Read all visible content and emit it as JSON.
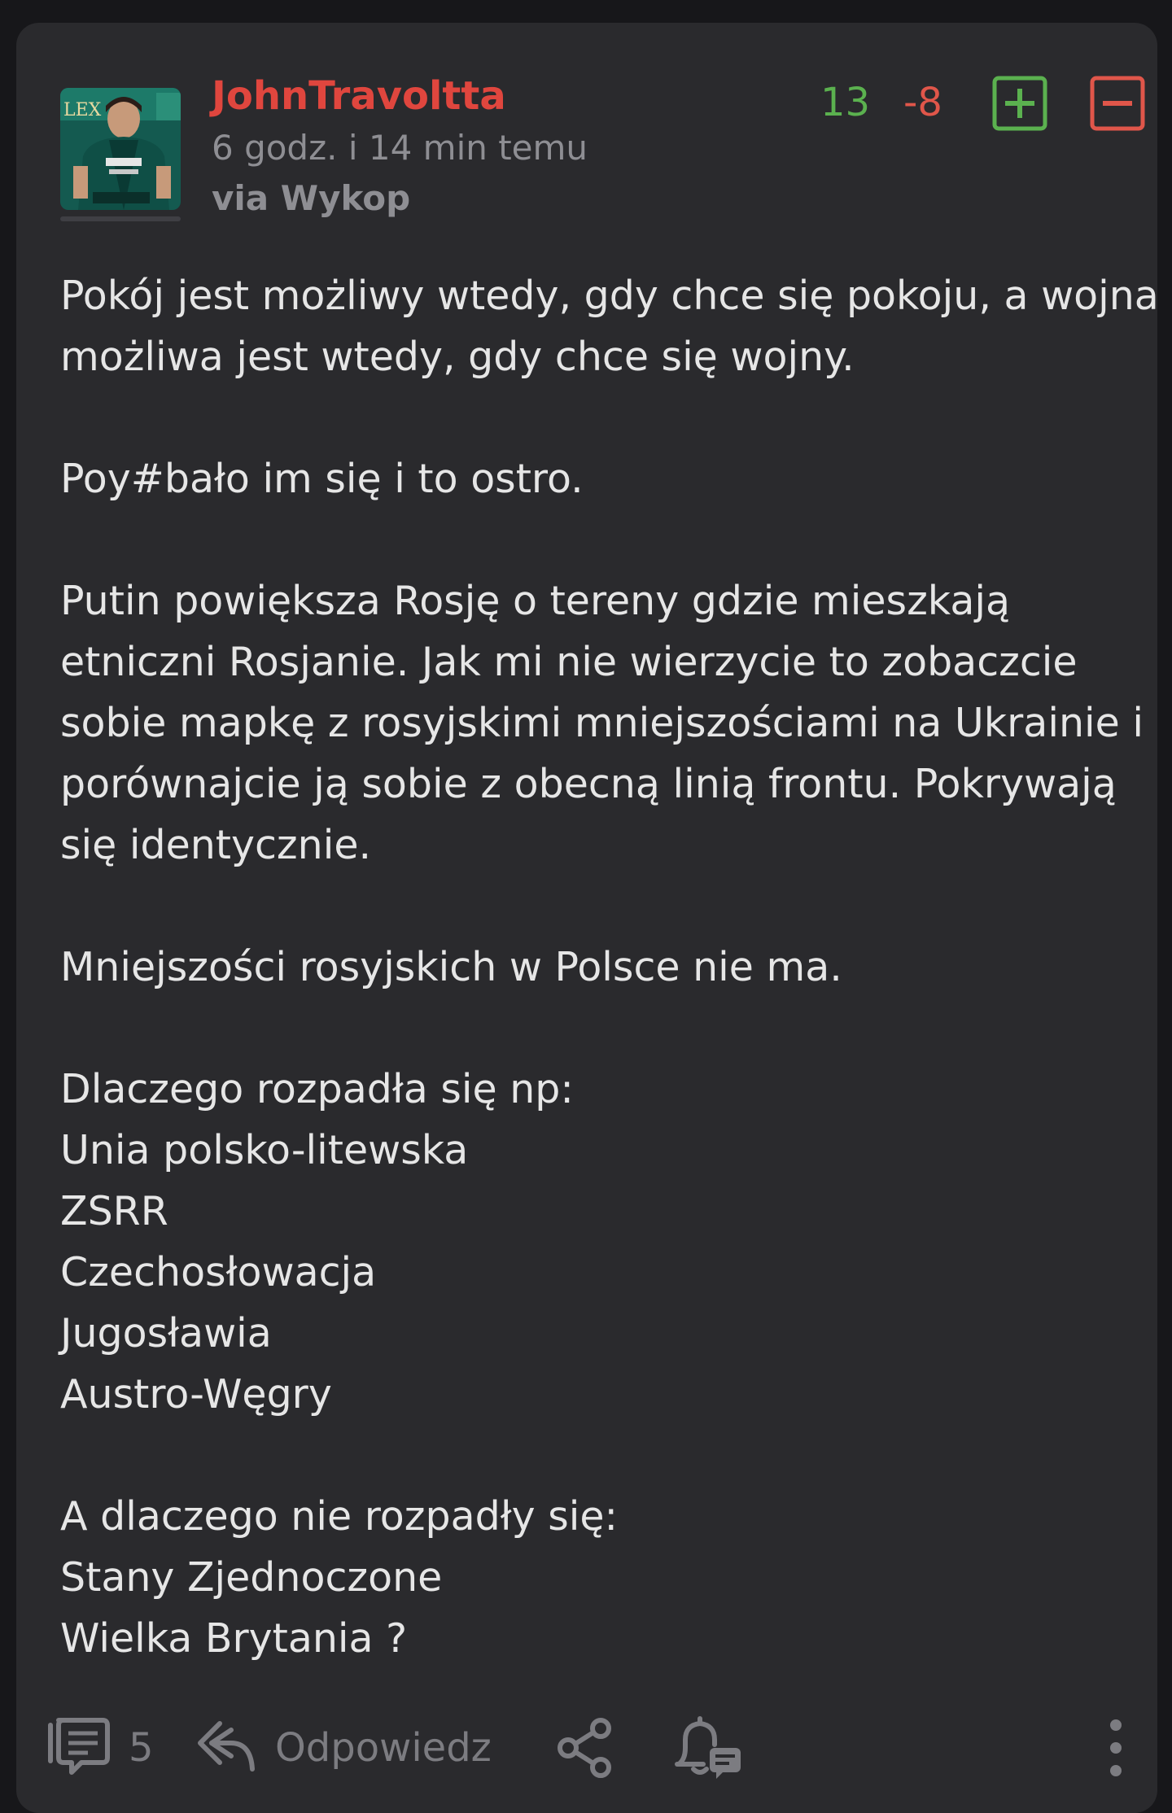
{
  "post": {
    "author": "JohnTravoltta",
    "timestamp": "6 godz. i 14 min temu",
    "source": "via Wykop",
    "avatar_icon": "user-avatar-photo",
    "votes": {
      "plus": "13",
      "minus": "-8",
      "plus_color": "#5bb14f",
      "minus_color": "#e0564a"
    },
    "paragraphs": [
      "Pokój jest możliwy wtedy, gdy chce się pokoju, a wojna możliwa jest wtedy, gdy chce się wojny.",
      "Poy#bało im się i to ostro.",
      "Putin powiększa Rosję o tereny gdzie mieszkają etniczni Rosjanie. Jak mi nie wierzycie to zobaczcie sobie mapkę z rosyjskimi mniejszościami na Ukrainie i porównajcie ją sobie z obecną linią frontu. Pokrywają się identycznie.",
      "Mniejszości rosyjskich w Polsce nie ma.",
      "Dlaczego rozpadła się np:\nUnia polsko-litewska\nZSRR\nCzechosłowacja\nJugosławia\nAustro-Węgry",
      "A dlaczego nie rozpadły się:\nStany Zjednoczone\nWielka Brytania ?"
    ]
  },
  "footer": {
    "comments_count": "5",
    "reply_label": "Odpowiedz",
    "icons": [
      "comments-icon",
      "reply-icon",
      "share-icon",
      "notification-bell-icon",
      "more-options-icon"
    ]
  },
  "colors": {
    "author": "#e0463e",
    "card_background": "#2a2a2d",
    "page_background": "#17171a"
  }
}
